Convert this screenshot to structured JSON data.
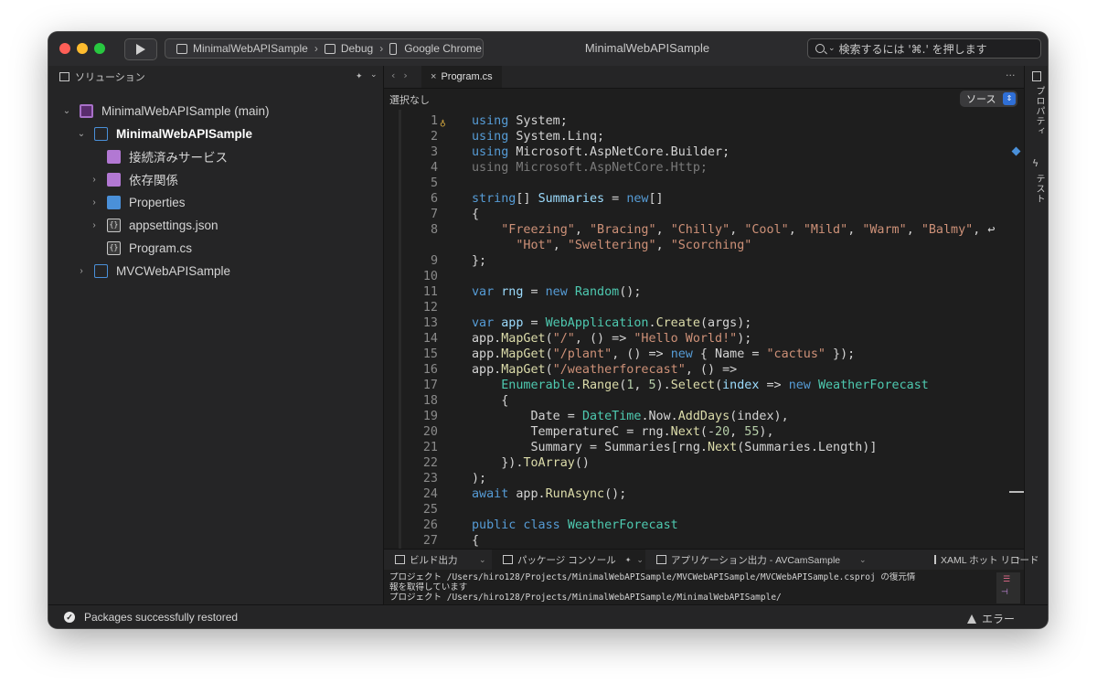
{
  "titlebar": {
    "title": "MinimalWebAPISample",
    "run_icon": "play-icon",
    "target": {
      "project": "MinimalWebAPISample",
      "config": "Debug",
      "device": "Google Chrome"
    },
    "search_placeholder": "検索するには '⌘.' を押します"
  },
  "solution_pane": {
    "title": "ソリューション",
    "items": [
      {
        "label": "MinimalWebAPISample (main)",
        "icon": "solution-icon",
        "expanded": true
      },
      {
        "label": "MinimalWebAPISample",
        "icon": "project-icon",
        "expanded": true,
        "bold": true
      },
      {
        "label": "接続済みサービス",
        "icon": "connected-services-icon"
      },
      {
        "label": "依存関係",
        "icon": "dependencies-icon",
        "expanded": false
      },
      {
        "label": "Properties",
        "icon": "folder-icon",
        "expanded": false
      },
      {
        "label": "appsettings.json",
        "icon": "json-file-icon",
        "expanded": false
      },
      {
        "label": "Program.cs",
        "icon": "code-file-icon"
      },
      {
        "label": "MVCWebAPISample",
        "icon": "project-icon",
        "expanded": false
      }
    ]
  },
  "editor": {
    "tab": "Program.cs",
    "selection": "選択なし",
    "source_label": "ソース",
    "lines": [
      {
        "n": "1",
        "parts": [
          [
            "kw",
            "using"
          ],
          [
            "",
            "System;"
          ]
        ]
      },
      {
        "n": "2",
        "parts": [
          [
            "kw",
            "using"
          ],
          [
            "",
            "System.Linq;"
          ]
        ]
      },
      {
        "n": "3",
        "parts": [
          [
            "kw",
            "using"
          ],
          [
            "",
            "Microsoft.AspNetCore.Builder;"
          ]
        ]
      },
      {
        "n": "4",
        "parts": [
          [
            "dim",
            "using Microsoft.AspNetCore.Http;"
          ]
        ]
      },
      {
        "n": "5",
        "parts": []
      },
      {
        "n": "6",
        "parts": [
          [
            "kw",
            "string"
          ],
          [
            "",
            "[] "
          ],
          [
            "vr",
            "Summaries"
          ],
          [
            "",
            " = "
          ],
          [
            "kw",
            "new"
          ],
          [
            "",
            "[]"
          ]
        ]
      },
      {
        "n": "7",
        "parts": [
          [
            "",
            "{"
          ]
        ]
      },
      {
        "n": "8",
        "parts": [
          [
            "",
            "    "
          ],
          [
            "st",
            "\"Freezing\""
          ],
          [
            "",
            ", "
          ],
          [
            "st",
            "\"Bracing\""
          ],
          [
            "",
            ", "
          ],
          [
            "st",
            "\"Chilly\""
          ],
          [
            "",
            ", "
          ],
          [
            "st",
            "\"Cool\""
          ],
          [
            "",
            ", "
          ],
          [
            "st",
            "\"Mild\""
          ],
          [
            "",
            ", "
          ],
          [
            "st",
            "\"Warm\""
          ],
          [
            "",
            ", "
          ],
          [
            "st",
            "\"Balmy\""
          ],
          [
            "",
            ", ↩"
          ]
        ]
      },
      {
        "n": "",
        "parts": [
          [
            "",
            "      "
          ],
          [
            "st",
            "\"Hot\""
          ],
          [
            "",
            ", "
          ],
          [
            "st",
            "\"Sweltering\""
          ],
          [
            "",
            ", "
          ],
          [
            "st",
            "\"Scorching\""
          ]
        ]
      },
      {
        "n": "9",
        "parts": [
          [
            "",
            "};"
          ]
        ]
      },
      {
        "n": "10",
        "parts": []
      },
      {
        "n": "11",
        "parts": [
          [
            "kw",
            "var"
          ],
          [
            "",
            " "
          ],
          [
            "vr",
            "rng"
          ],
          [
            "",
            " = "
          ],
          [
            "kw",
            "new"
          ],
          [
            "",
            " "
          ],
          [
            "ty",
            "Random"
          ],
          [
            "",
            "();"
          ]
        ]
      },
      {
        "n": "12",
        "parts": []
      },
      {
        "n": "13",
        "parts": [
          [
            "kw",
            "var"
          ],
          [
            "",
            " "
          ],
          [
            "vr",
            "app"
          ],
          [
            "",
            " = "
          ],
          [
            "ty",
            "WebApplication"
          ],
          [
            "",
            "."
          ],
          [
            "fn",
            "Create"
          ],
          [
            "",
            "(args);"
          ]
        ]
      },
      {
        "n": "14",
        "parts": [
          [
            "",
            "app."
          ],
          [
            "fn",
            "MapGet"
          ],
          [
            "",
            "("
          ],
          [
            "st",
            "\"/\""
          ],
          [
            "",
            ", () => "
          ],
          [
            "st",
            "\"Hello World!\""
          ],
          [
            "",
            ");"
          ]
        ]
      },
      {
        "n": "15",
        "parts": [
          [
            "",
            "app."
          ],
          [
            "fn",
            "MapGet"
          ],
          [
            "",
            "("
          ],
          [
            "st",
            "\"/plant\""
          ],
          [
            "",
            ", () => "
          ],
          [
            "kw",
            "new"
          ],
          [
            "",
            " { Name = "
          ],
          [
            "st",
            "\"cactus\""
          ],
          [
            "",
            " });"
          ]
        ]
      },
      {
        "n": "16",
        "parts": [
          [
            "",
            "app."
          ],
          [
            "fn",
            "MapGet"
          ],
          [
            "",
            "("
          ],
          [
            "st",
            "\"/weatherforecast\""
          ],
          [
            "",
            ", () =>"
          ]
        ]
      },
      {
        "n": "17",
        "parts": [
          [
            "",
            "    "
          ],
          [
            "ty",
            "Enumerable"
          ],
          [
            "",
            "."
          ],
          [
            "fn",
            "Range"
          ],
          [
            "",
            "("
          ],
          [
            "nm",
            "1"
          ],
          [
            "",
            ", "
          ],
          [
            "nm",
            "5"
          ],
          [
            "",
            ")."
          ],
          [
            "fn",
            "Select"
          ],
          [
            "",
            "("
          ],
          [
            "vr",
            "index"
          ],
          [
            "",
            " => "
          ],
          [
            "kw",
            "new"
          ],
          [
            "",
            " "
          ],
          [
            "ty",
            "WeatherForecast"
          ]
        ]
      },
      {
        "n": "18",
        "parts": [
          [
            "",
            "    {"
          ]
        ]
      },
      {
        "n": "19",
        "parts": [
          [
            "",
            "        Date = "
          ],
          [
            "ty",
            "DateTime"
          ],
          [
            "",
            ".Now."
          ],
          [
            "fn",
            "AddDays"
          ],
          [
            "",
            "(index),"
          ]
        ]
      },
      {
        "n": "20",
        "parts": [
          [
            "",
            "        TemperatureC = rng."
          ],
          [
            "fn",
            "Next"
          ],
          [
            "",
            "(-"
          ],
          [
            "nm",
            "20"
          ],
          [
            "",
            ", "
          ],
          [
            "nm",
            "55"
          ],
          [
            "",
            "),"
          ]
        ]
      },
      {
        "n": "21",
        "parts": [
          [
            "",
            "        Summary = Summaries[rng."
          ],
          [
            "fn",
            "Next"
          ],
          [
            "",
            "(Summaries.Length)]"
          ]
        ]
      },
      {
        "n": "22",
        "parts": [
          [
            "",
            "    })."
          ],
          [
            "fn",
            "ToArray"
          ],
          [
            "",
            "()"
          ]
        ]
      },
      {
        "n": "23",
        "parts": [
          [
            "",
            ");"
          ]
        ]
      },
      {
        "n": "24",
        "parts": [
          [
            "kw",
            "await"
          ],
          [
            "",
            " app."
          ],
          [
            "fn",
            "RunAsync"
          ],
          [
            "",
            "();"
          ]
        ]
      },
      {
        "n": "25",
        "parts": []
      },
      {
        "n": "26",
        "parts": [
          [
            "kw",
            "public class"
          ],
          [
            "",
            " "
          ],
          [
            "ty",
            "WeatherForecast"
          ]
        ]
      },
      {
        "n": "27",
        "parts": [
          [
            "",
            "{"
          ]
        ]
      }
    ]
  },
  "right_strip": {
    "properties": "プロパティ",
    "tests": "テスト"
  },
  "bottom_panel": {
    "tabs": [
      "ビルド出力",
      "パッケージ コンソール",
      "アプリケーション出力 - AVCamSample",
      "XAML ホット リロード"
    ],
    "output": [
      "プロジェクト /Users/hiro128/Projects/MinimalWebAPISample/MVCWebAPISample/MVCWebAPISample.csproj の復元情",
      "報を取得しています",
      "プロジェクト /Users/hiro128/Projects/MinimalWebAPISample/MinimalWebAPISample/"
    ]
  },
  "status_bar": {
    "message": "Packages successfully restored",
    "errors": "エラー"
  }
}
